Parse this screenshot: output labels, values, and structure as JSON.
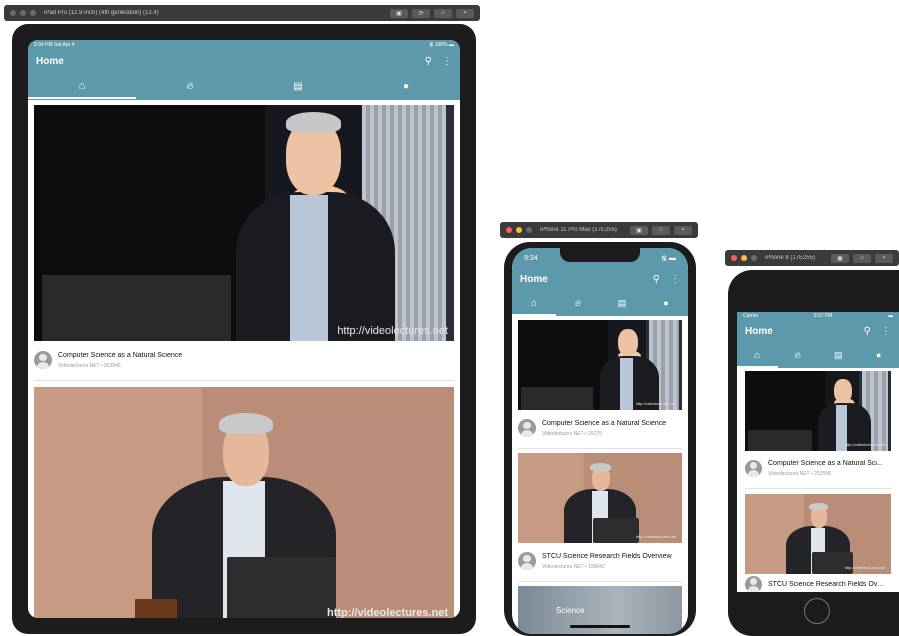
{
  "simulators": [
    {
      "title": "iPad Pro (12.9-inch) (4th generation) (13.4)"
    },
    {
      "title": "iPhone 11 Pro Max (17E255)"
    },
    {
      "title": "iPhone 8 (17E255)"
    }
  ],
  "ipad": {
    "status_time": "9:34 PM  Sat Apr 4",
    "status_right": "100%",
    "header_title": "Home",
    "videos": [
      {
        "title": "Computer Science as a Natural Science",
        "sub": "Videolectures.NET  • 923946",
        "watermark": "http://videolectures.net"
      },
      {
        "title": "",
        "sub": "",
        "watermark": "http://videolectures.net"
      }
    ]
  },
  "iphone11": {
    "status_time": "9:34",
    "header_title": "Home",
    "videos": [
      {
        "title": "Computer Science as a Natural Science",
        "sub": "Videolectures.NET  • 25275",
        "watermark": "http://videolectures.net"
      },
      {
        "title": "STCU Science Research Fields Overview",
        "sub": "Videolectures.NET  • 199642",
        "watermark": "http://videolectures.net"
      },
      {
        "title": "",
        "sub": "",
        "watermark": "Science"
      }
    ]
  },
  "iphone8": {
    "status_carrier": "Carrier",
    "status_time": "9:37 PM",
    "header_title": "Home",
    "videos": [
      {
        "title": "Computer Science as a Natural Sci...",
        "sub": "Videolectures.NET  • 251558",
        "watermark": "http://videolectures.net"
      },
      {
        "title": "STCU Science Research Fields Ove...",
        "sub": "",
        "watermark": "http://videolectures.net"
      }
    ]
  },
  "colors": {
    "header": "#5c9aab",
    "frame": "#1c1c1e"
  }
}
